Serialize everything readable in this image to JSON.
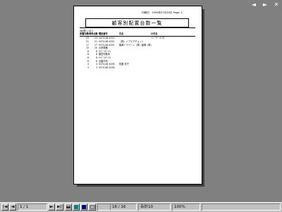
{
  "window": {
    "controls": [
      "◄",
      "►",
      "✕"
    ]
  },
  "report": {
    "meta_line": "印刷日：1999年07月30日  Page: 1",
    "title": "顧客別配置台数一覧",
    "sub_label": "Wd表 [ 16 ]",
    "headers": [
      "配置台数",
      "現時点数",
      "電話番号",
      "氏名",
      "ｶﾅ氏名"
    ],
    "rows": [
      [
        "23",
        "23",
        "0474-46-4251",
        "",
        "ｲﾝｿﾞｳﾃﾞﾝﾁｼﾖｳ"
      ],
      [
        "21",
        "21",
        "0474-46-4252",
        "（株）ノブエアチョット",
        ""
      ],
      [
        "17",
        "17",
        "0474-46-4252",
        "臨海トラベーン（株）臨海（株）",
        ""
      ],
      [
        "10",
        "10",
        "小林電器",
        "",
        ""
      ],
      [
        "8",
        "8",
        "ｶｲｺﾞﾐﾂｷﾞｲﾃﾝ",
        "",
        ""
      ],
      [
        "8",
        "8",
        "藤堂村基本",
        "",
        ""
      ],
      [
        "8",
        "8",
        "ﾔｲｺﾞﾐﾂｷﾞｲﾃﾝ",
        "",
        ""
      ],
      [
        "6",
        "6",
        "近藤平司",
        "",
        ""
      ],
      [
        "4",
        "4",
        "0474-46-4256",
        "佐藤 花子",
        ""
      ],
      [
        "3",
        "3",
        "0474-46-4258",
        "",
        ""
      ]
    ]
  },
  "statusbar": {
    "first": "|◄",
    "prev": "◄",
    "page": "1 / 1",
    "next": "►",
    "last": "►|",
    "count": "16 / 16",
    "total": "合計10",
    "zoom": "100%"
  }
}
